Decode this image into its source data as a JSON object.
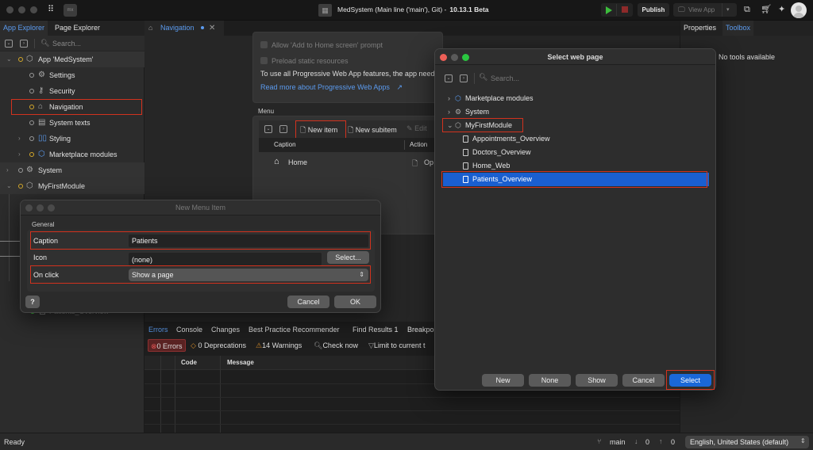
{
  "titlebar": {
    "app_logo": "mx",
    "title": "MedSystem (Main line ('main'), Git) -",
    "version": "10.13.1 Beta",
    "publish_label": "Publish",
    "view_app_label": "View App",
    "icons": [
      "grid-icon",
      "calendar-icon",
      "play-icon",
      "stop-icon",
      "monitor-icon",
      "chat-icon",
      "cart-icon",
      "sparkle-icon",
      "avatar"
    ]
  },
  "left_panel": {
    "tabs": [
      {
        "label": "App Explorer",
        "active": true
      },
      {
        "label": "Page Explorer",
        "active": false
      }
    ],
    "search_placeholder": "Search...",
    "tree": [
      {
        "label": "App 'MedSystem'",
        "level": 0,
        "expanded": true,
        "icon": "app-icon"
      },
      {
        "label": "Settings",
        "level": 1,
        "icon": "gear-icon"
      },
      {
        "label": "Security",
        "level": 1,
        "icon": "key-icon"
      },
      {
        "label": "Navigation",
        "level": 1,
        "icon": "home-icon",
        "highlighted": true
      },
      {
        "label": "System texts",
        "level": 1,
        "icon": "text-icon"
      },
      {
        "label": "Styling",
        "level": 1,
        "icon": "styling-icon",
        "expandable": true
      },
      {
        "label": "Marketplace modules",
        "level": 1,
        "icon": "module-icon",
        "expandable": true
      },
      {
        "label": "System",
        "level": 0,
        "icon": "system-icon",
        "expandable": true
      },
      {
        "label": "MyFirstModule",
        "level": 0,
        "icon": "module-icon",
        "expanded": true
      }
    ],
    "hidden_item": "Patients_Overview"
  },
  "editor": {
    "tab_label": "Navigation",
    "pwa": {
      "allow_home_prompt": "Allow 'Add to Home screen' prompt",
      "preload_resources": "Preload static resources",
      "note": "To use all Progressive Web App features, the app need",
      "link": "Read more about Progressive Web Apps"
    },
    "menu": {
      "section_label": "Menu",
      "new_item": "New item",
      "new_subitem": "New subitem",
      "edit": "Edit",
      "columns": [
        "Caption",
        "Action"
      ],
      "rows": [
        {
          "caption": "Home",
          "action": "Op"
        }
      ]
    }
  },
  "bottom_pane": {
    "tabs": [
      "Errors",
      "Console",
      "Changes",
      "Best Practice Recommender",
      "Find Results 1",
      "Breakpo"
    ],
    "filters": {
      "errors": "0 Errors",
      "deprecations": "0 Deprecations",
      "warnings": "14 Warnings",
      "check_now": "Check now",
      "limit": "Limit to current t"
    },
    "columns": [
      "Code",
      "Message"
    ]
  },
  "right_panel": {
    "tabs": [
      {
        "label": "Properties",
        "active": false
      },
      {
        "label": "Toolbox",
        "active": true
      }
    ],
    "empty_message": "No tools available"
  },
  "new_menu_item_dialog": {
    "title": "New Menu Item",
    "group_label": "General",
    "caption_label": "Caption",
    "caption_value": "Patients",
    "icon_label": "Icon",
    "icon_value": "(none)",
    "select_button": "Select...",
    "onclick_label": "On click",
    "onclick_value": "Show a page",
    "help_button": "?",
    "cancel_button": "Cancel",
    "ok_button": "OK"
  },
  "select_web_page_dialog": {
    "title": "Select web page",
    "search_placeholder": "Search...",
    "tree": [
      {
        "label": "Marketplace modules",
        "expandable": true
      },
      {
        "label": "System",
        "expandable": true
      },
      {
        "label": "MyFirstModule",
        "expanded": true
      },
      {
        "label": "Appointments_Overview"
      },
      {
        "label": "Doctors_Overview"
      },
      {
        "label": "Home_Web"
      },
      {
        "label": "Patients_Overview",
        "selected": true
      }
    ],
    "buttons": {
      "new": "New",
      "none": "None",
      "show": "Show",
      "cancel": "Cancel",
      "select": "Select"
    }
  },
  "status_bar": {
    "status": "Ready",
    "branch": "main",
    "incoming": "0",
    "outgoing": "0",
    "language": "English, United States (default)"
  },
  "colors": {
    "accent": "#5b9bef",
    "selection": "#1a5fd0",
    "primary_button": "#1a68d8",
    "annotation_red": "#d2321e",
    "error_red": "#8c3030"
  }
}
